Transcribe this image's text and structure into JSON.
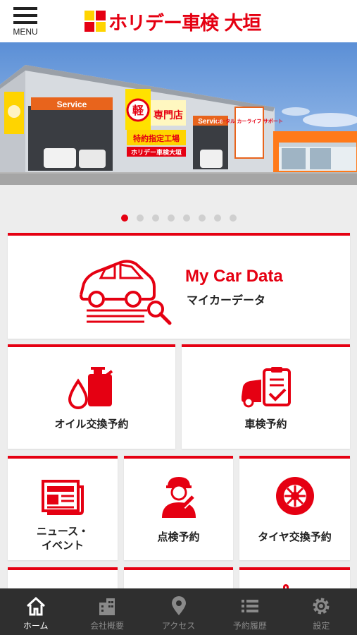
{
  "header": {
    "menu_label": "MENU",
    "logo_text": "ホリデー車検 大垣",
    "brand_red": "#e50012",
    "brand_yellow": "#ffd400"
  },
  "hero": {
    "sign_service_left": "Service",
    "sign_service_right": "Service",
    "sign_kei": "軽",
    "sign_specialty": "専門店",
    "sign_designated": "特約指定工場",
    "sign_support": "トータル カーライフ サポート",
    "sign_holiday": "ホリデー車検大垣",
    "slide_count": 8,
    "active_slide": 1
  },
  "tiles": {
    "mycar_title": "My Car Data",
    "mycar_sub": "マイカーデータ",
    "oil_label": "オイル交換予約",
    "shaken_label": "車検予約",
    "news_label_1": "ニュース・",
    "news_label_2": "イベント",
    "inspection_label": "点検予約",
    "tire_label": "タイヤ交換予約"
  },
  "tabbar": {
    "items": [
      {
        "label": "ホーム",
        "icon": "home-icon",
        "active": true
      },
      {
        "label": "会社概要",
        "icon": "building-icon",
        "active": false
      },
      {
        "label": "アクセス",
        "icon": "map-pin-icon",
        "active": false
      },
      {
        "label": "予約履歴",
        "icon": "list-icon",
        "active": false
      },
      {
        "label": "設定",
        "icon": "gear-icon",
        "active": false
      }
    ]
  }
}
